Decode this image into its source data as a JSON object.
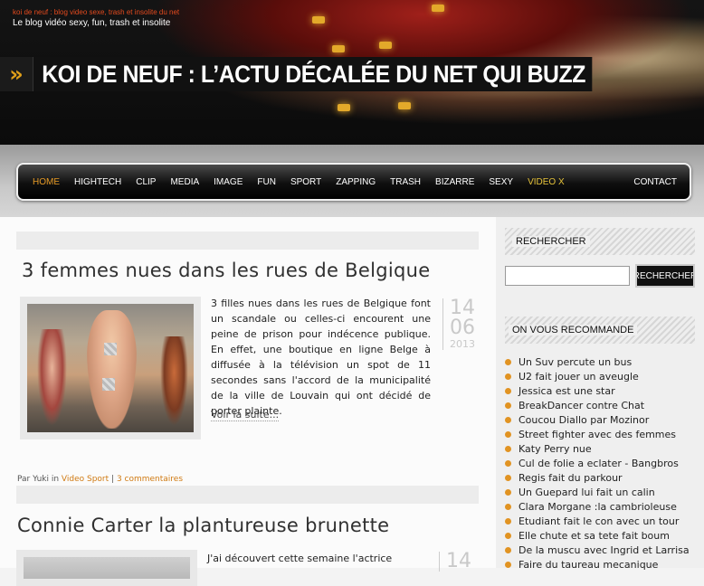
{
  "header": {
    "small_tag": "koi de neuf : blog video sexe, trash et insolite du net",
    "tagline": "Le blog vidéo sexy, fun, trash et insolite",
    "banner_arrow": "»",
    "banner_title": "KOI DE NEUF : L’ACTU DÉCALÉE DU NET QUI BUZZ"
  },
  "nav": {
    "items": [
      "HOME",
      "HIGHTECH",
      "CLIP",
      "MEDIA",
      "IMAGE",
      "FUN",
      "SPORT",
      "ZAPPING",
      "TRASH",
      "BIZARRE",
      "SEXY",
      "VIDEO X"
    ],
    "contact": "CONTACT",
    "active_color": "#e69a25",
    "highlight_color": "#e6c33a"
  },
  "posts": [
    {
      "title": "3 femmes nues dans les rues de Belgique",
      "excerpt": "3 filles nues dans les rues de Belgique font un scandale ou celles-ci encourent une peine de prison pour indécence publique. En effet, une boutique en ligne Belge à diffusée à la télévision un spot de 11 secondes sans l'accord de la municipalité de la ville de Louvain qui ont décidé de porter plainte.",
      "date_day": "14",
      "date_month": "06",
      "date_year": "2013",
      "readmore": "Voir la suite...",
      "meta_by": "Par Yuki in ",
      "meta_category": "Video Sport",
      "meta_sep": " | ",
      "meta_comments": "3 commentaires"
    },
    {
      "title": "Connie Carter la plantureuse brunette",
      "excerpt": "J'ai découvert cette semaine l'actrice",
      "date_day": "14"
    }
  ],
  "sidebar": {
    "search_heading": "RECHERCHER",
    "search_button": "RECHERCHER",
    "recommend_heading": "ON VOUS RECOMMANDE",
    "recommendations": [
      "Un Suv percute un bus",
      "U2 fait jouer un aveugle",
      "Jessica est une star",
      "BreakDancer contre Chat",
      "Coucou Diallo par Mozinor",
      "Street fighter avec des femmes",
      "Katy Perry nue",
      "Cul de folie a eclater - Bangbros",
      "Regis fait du parkour",
      "Un Guepard lui fait un calin",
      "Clara Morgane :la cambrioleuse",
      "Etudiant fait le con avec un tour",
      "Elle chute et sa tete fait boum",
      "De la muscu avec Ingrid et Larrisa",
      "Faire du taureau mecanique"
    ],
    "bullet_color": "#e19322"
  }
}
